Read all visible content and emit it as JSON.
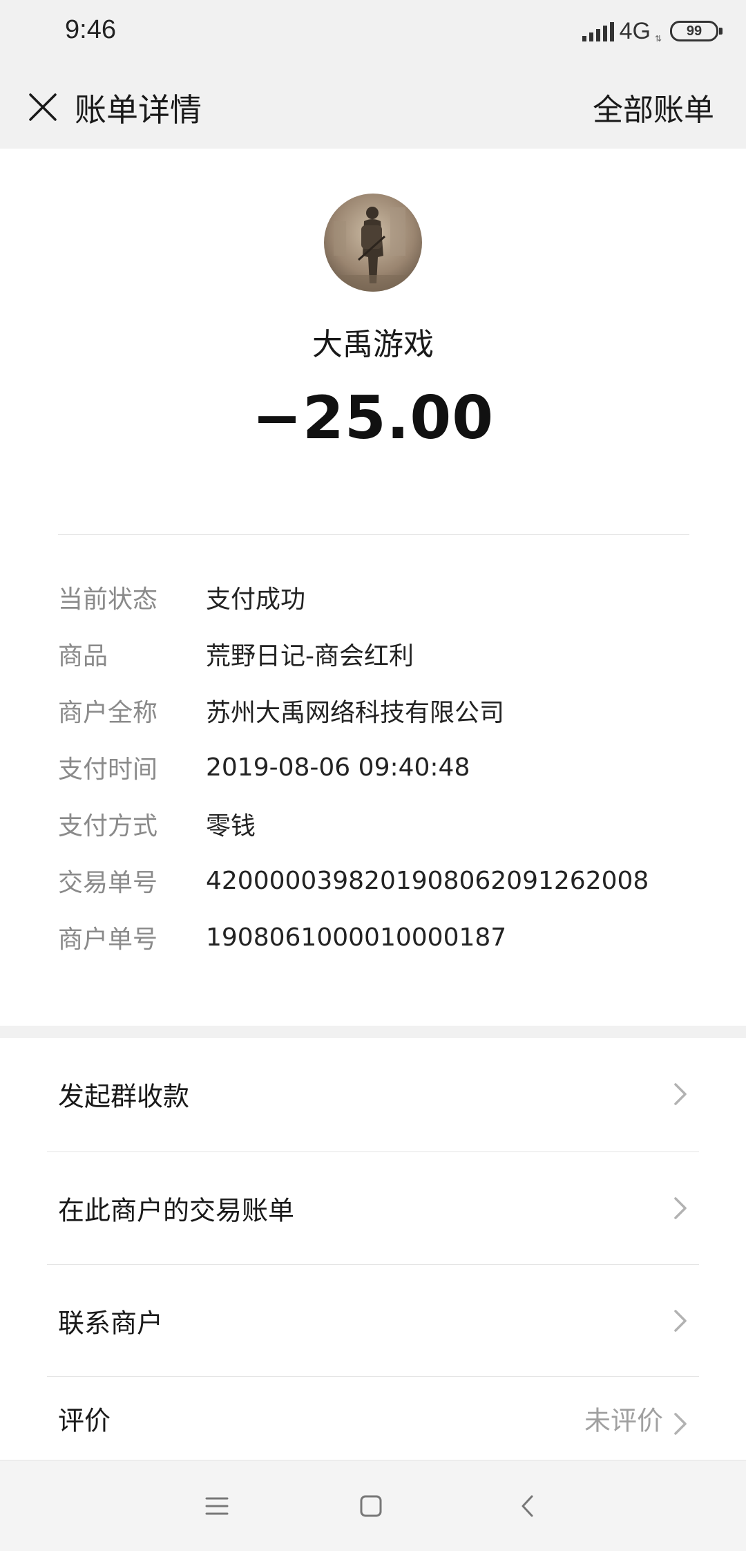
{
  "status_bar": {
    "time": "9:46",
    "network": "4G",
    "battery": "99",
    "icons": [
      "signal-icon",
      "network-4g-icon",
      "battery-icon"
    ]
  },
  "nav": {
    "title": "账单详情",
    "right_link": "全部账单",
    "close_icon": "close-icon"
  },
  "merchant": {
    "name": "大禹游戏",
    "amount": "−25.00",
    "avatar": "merchant-avatar"
  },
  "details": [
    {
      "label": "当前状态",
      "value": "支付成功"
    },
    {
      "label": "商品",
      "value": "荒野日记-商会红利"
    },
    {
      "label": "商户全称",
      "value": "苏州大禹网络科技有限公司"
    },
    {
      "label": "支付时间",
      "value": "2019-08-06 09:40:48"
    },
    {
      "label": "支付方式",
      "value": "零钱"
    },
    {
      "label": "交易单号",
      "value": "4200000398201908062091262008"
    },
    {
      "label": "商户单号",
      "value": "1908061000010000187"
    }
  ],
  "actions": [
    {
      "label": "发起群收款",
      "value": ""
    },
    {
      "label": "在此商户的交易账单",
      "value": ""
    },
    {
      "label": "联系商户",
      "value": ""
    },
    {
      "label": "评价",
      "value": "未评价"
    }
  ],
  "system_nav": {
    "icons": [
      "menu-icon",
      "home-icon",
      "back-icon"
    ]
  },
  "colors": {
    "header_bg": "#f1f1f1",
    "label_gray": "#8a8a8a",
    "text_dark": "#191919"
  }
}
